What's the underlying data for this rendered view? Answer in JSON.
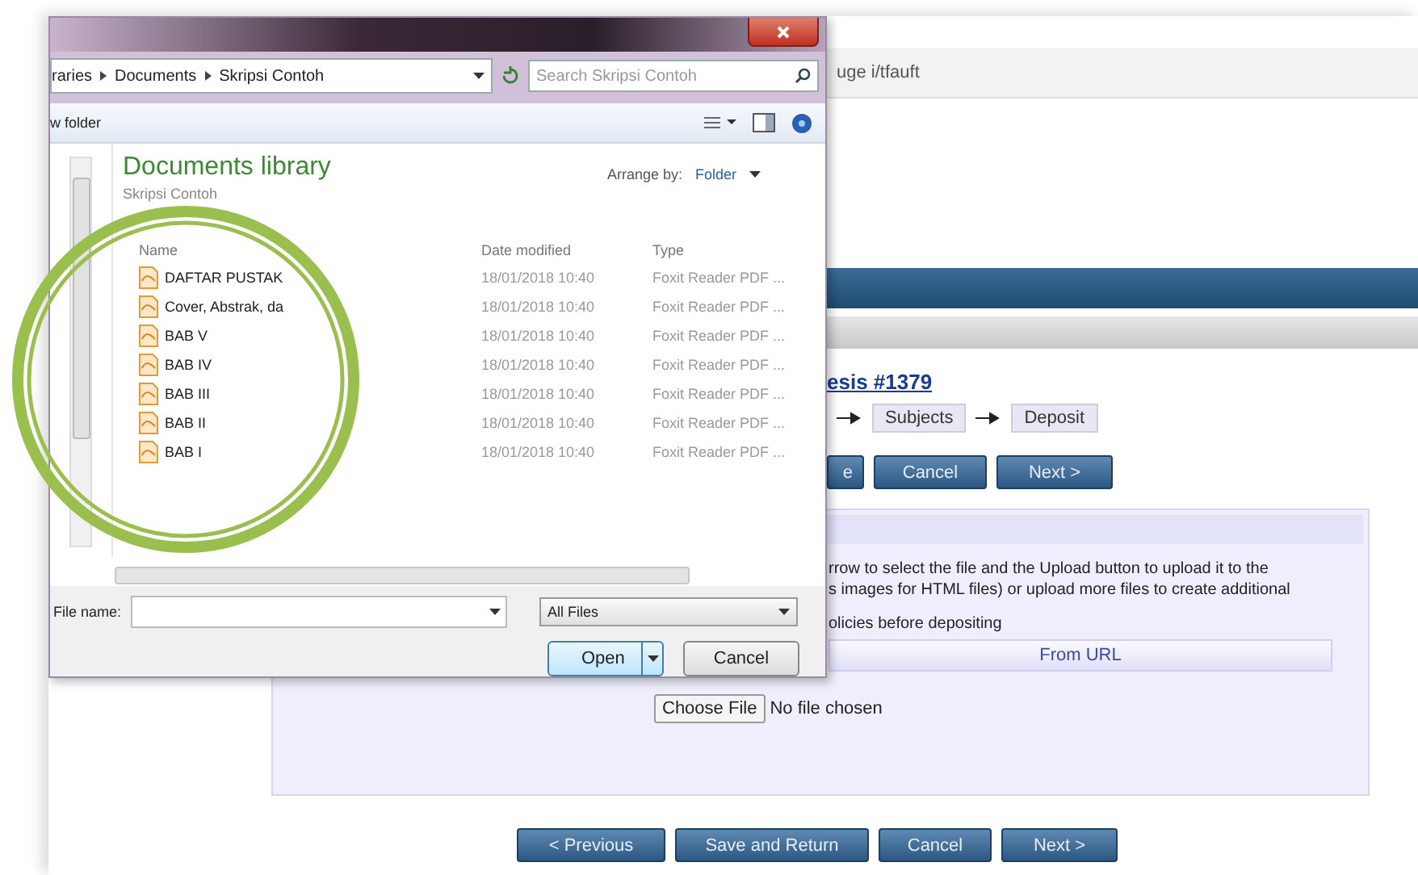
{
  "page": {
    "address_fragment": "uge i/tfauft",
    "title_link": "esis #1379",
    "steps": [
      {
        "label": "Subjects"
      },
      {
        "label": "Deposit"
      }
    ],
    "top_buttons": [
      "e",
      "Cancel",
      "Next >"
    ],
    "instructions": [
      "rrow to select the file and the Upload button to upload it to the",
      "s images for HTML files) or upload more files to create additional"
    ],
    "policy_note": "olicies before depositing",
    "upload_tab": "From URL",
    "choose_file": "Choose File",
    "no_file": "No file chosen",
    "bottom_buttons": [
      "< Previous",
      "Save and Return",
      "Cancel",
      "Next >"
    ]
  },
  "dialog": {
    "breadcrumb": [
      "raries",
      "Documents",
      "Skripsi Contoh"
    ],
    "search": {
      "placeholder": "Search Skripsi Contoh"
    },
    "new_folder": "w folder",
    "library_title": "Documents library",
    "library_subtitle": "Skripsi Contoh",
    "arrange_label": "Arrange by:",
    "arrange_value": "Folder",
    "columns": [
      "Name",
      "Date modified",
      "Type"
    ],
    "files": [
      {
        "name": "DAFTAR PUSTAK",
        "date": "18/01/2018 10:40",
        "type": "Foxit Reader PDF ..."
      },
      {
        "name": "Cover, Abstrak, da",
        "date": "18/01/2018 10:40",
        "type": "Foxit Reader PDF ..."
      },
      {
        "name": "BAB V",
        "date": "18/01/2018 10:40",
        "type": "Foxit Reader PDF ..."
      },
      {
        "name": "BAB IV",
        "date": "18/01/2018 10:40",
        "type": "Foxit Reader PDF ..."
      },
      {
        "name": "BAB III",
        "date": "18/01/2018 10:40",
        "type": "Foxit Reader PDF ..."
      },
      {
        "name": "BAB II",
        "date": "18/01/2018 10:40",
        "type": "Foxit Reader PDF ..."
      },
      {
        "name": "BAB I",
        "date": "18/01/2018 10:40",
        "type": "Foxit Reader PDF ..."
      }
    ],
    "file_name_label": "File name:",
    "file_type": "All Files",
    "open_button": "Open",
    "cancel_button": "Cancel"
  }
}
